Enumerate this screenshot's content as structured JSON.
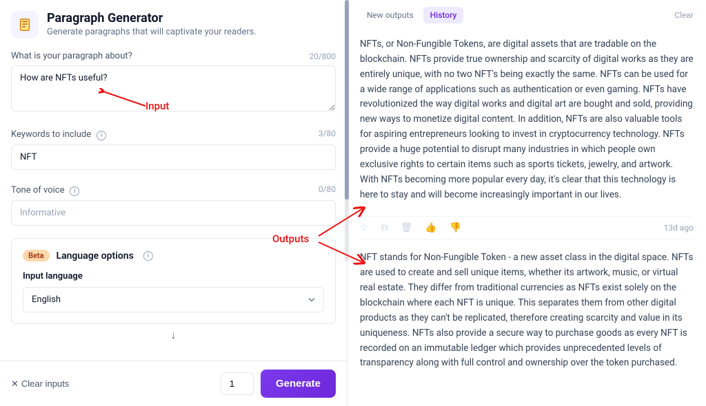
{
  "header": {
    "title": "Paragraph Generator",
    "subtitle": "Generate paragraphs that will captivate your readers."
  },
  "topic": {
    "label": "What is your paragraph about?",
    "count": "20/800",
    "value": "How are NFTs useful?"
  },
  "keywords": {
    "label": "Keywords to include",
    "count": "3/80",
    "value": "NFT"
  },
  "tone": {
    "label": "Tone of voice",
    "count": "0/80",
    "placeholder": "Informative"
  },
  "language": {
    "badge": "Beta",
    "title": "Language options",
    "input_label": "Input language",
    "selected": "English"
  },
  "footer": {
    "clear": "Clear inputs",
    "count": "1",
    "generate": "Generate"
  },
  "right": {
    "tab_new": "New outputs",
    "tab_history": "History",
    "clear": "Clear",
    "meta_time": "13d ago"
  },
  "outputs": {
    "0": "NFTs, or Non-Fungible Tokens, are digital assets that are tradable on the blockchain. NFTs provide true ownership and scarcity of digital works as they are entirely unique, with no two NFT's being exactly the same. NFTs can be used for a wide range of applications such as authentication or even gaming. NFTs have revolutionized the way digital works and digital art are bought and sold, providing new ways to monetize digital content. In addition, NFTs are also valuable tools for aspiring entrepreneurs looking to invest in cryptocurrency technology. NFTs provide a huge potential to disrupt many industries in which people own exclusive rights to certain items such as sports tickets, jewelry, and artwork. With NFTs becoming more popular every day, it's clear that this technology is here to stay and will become increasingly important in our lives.",
    "1": "NFT stands for Non-Fungible Token - a new asset class in the digital space. NFTs are used to create and sell unique items, whether its artwork, music, or virtual real estate. They differ from traditional currencies as NFTs exist solely on the blockchain where each NFT is unique. This separates them from other digital products as they can't be replicated, therefore creating scarcity and value in its uniqueness. NFTs also provide a secure way to purchase goods as every NFT is recorded on an immutable ledger which provides unprecedented levels of transparency along with full control and ownership over the token purchased."
  },
  "annotations": {
    "input": "Input",
    "outputs": "Outputs"
  }
}
